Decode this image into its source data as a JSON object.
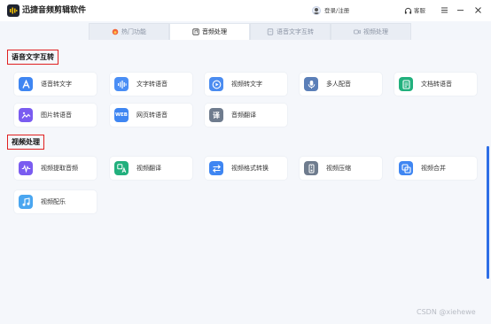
{
  "window": {
    "title": "迅捷音频剪辑软件",
    "login_label": "登录/注册",
    "help_label": "客服"
  },
  "tabs": [
    {
      "label": "热门功能",
      "active": false,
      "icon": "flame-icon"
    },
    {
      "label": "音频处理",
      "active": true,
      "icon": "audio-file-icon"
    },
    {
      "label": "语音文字互转",
      "active": false,
      "icon": "document-icon"
    },
    {
      "label": "视频处理",
      "active": false,
      "icon": "video-camera-icon"
    }
  ],
  "sections": {
    "speech_text": {
      "title": "语音文字互转",
      "items": [
        {
          "label": "语音转文字",
          "icon": "letter-a-icon",
          "color": "#3f86f2"
        },
        {
          "label": "文字转语音",
          "icon": "sound-wave-icon",
          "color": "#4a8ef5"
        },
        {
          "label": "视频转文字",
          "icon": "play-circle-icon",
          "color": "#4b8cf0"
        },
        {
          "label": "多人配音",
          "icon": "microphone-icon",
          "color": "#5b7fb8"
        },
        {
          "label": "文档转语音",
          "icon": "document-lines-icon",
          "color": "#22b07d"
        },
        {
          "label": "图片转语音",
          "icon": "image-wave-icon",
          "color": "#7a5cf0"
        },
        {
          "label": "网页转语音",
          "icon": "web-icon",
          "color": "#3f86f2",
          "icon_text": "WEB"
        },
        {
          "label": "音频翻译",
          "icon": "translate-icon",
          "color": "#6f7c8e",
          "icon_text": "译"
        }
      ]
    },
    "video": {
      "title": "视频处理",
      "items": [
        {
          "label": "视频提取音频",
          "icon": "waveform-icon",
          "color": "#7a5cf0"
        },
        {
          "label": "视频翻译",
          "icon": "translate-video-icon",
          "color": "#22b07d"
        },
        {
          "label": "视频格式转换",
          "icon": "swap-arrows-icon",
          "color": "#3f86f2"
        },
        {
          "label": "视频压缩",
          "icon": "compress-icon",
          "color": "#6f7c8e"
        },
        {
          "label": "视频合并",
          "icon": "merge-icon",
          "color": "#3f86f2"
        },
        {
          "label": "视频配乐",
          "icon": "music-note-icon",
          "color": "#4aa6f0"
        }
      ]
    }
  },
  "watermark": "CSDN @xiehewe"
}
